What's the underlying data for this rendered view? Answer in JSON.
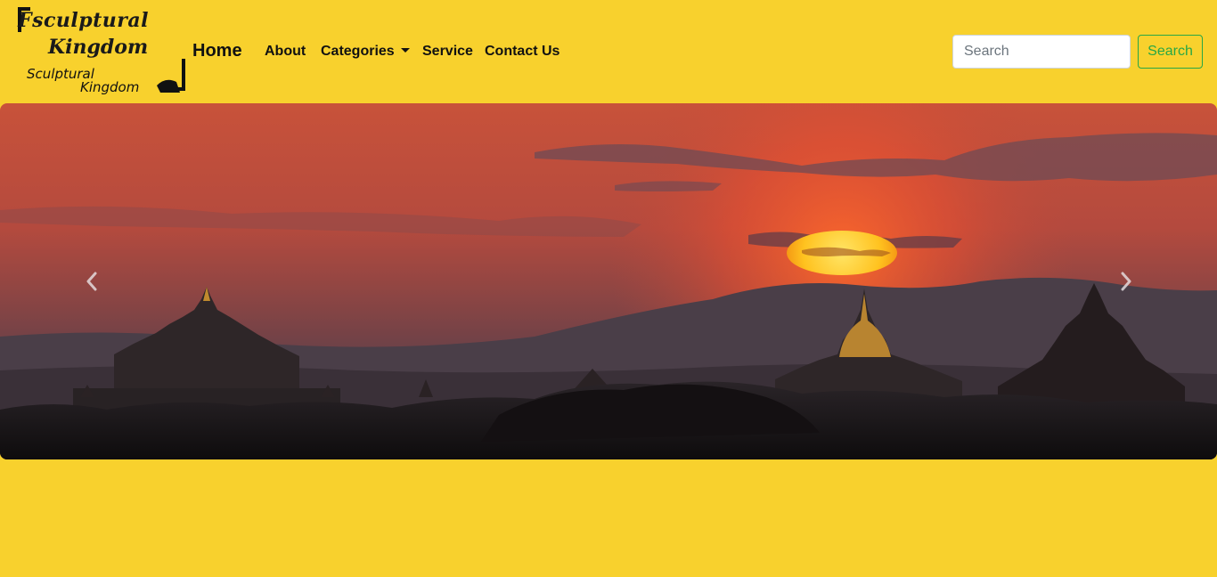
{
  "navbar": {
    "logo": {
      "line1": "Fsculptural",
      "line2": "Kingdom",
      "line3": "Sculptural",
      "line4": "Kingdom"
    },
    "brand": "Home",
    "links": [
      "About",
      "Categories",
      "Service",
      "Contact Us"
    ],
    "search": {
      "placeholder": "Search",
      "value": "",
      "button_label": "Search"
    }
  },
  "carousel": {
    "image_icon": "sunset-pagodas-image",
    "prev_icon": "chevron-left-icon",
    "next_icon": "chevron-right-icon"
  },
  "colors": {
    "page_background": "#f8d12d",
    "search_button": "#28a745",
    "nav_text": "#111111"
  }
}
